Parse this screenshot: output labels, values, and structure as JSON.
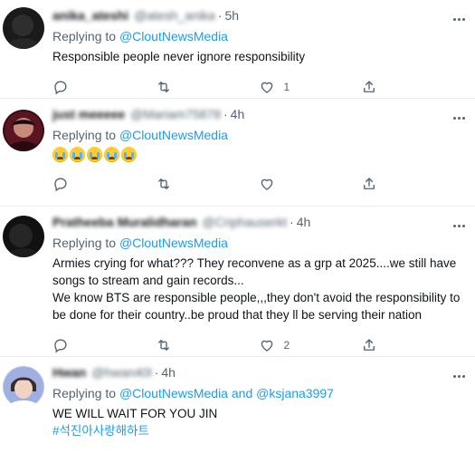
{
  "tweets": [
    {
      "name": "anika_ateshi",
      "handle": "@atesh_anika",
      "time": "5h",
      "replying_prefix": "Replying to",
      "mentions": [
        "@CloutNewsMedia"
      ],
      "text": "Responsible people never ignore  responsibility",
      "counts": {
        "reply": "",
        "retweet": "",
        "like": "1"
      }
    },
    {
      "name": "just meeeee",
      "handle": "@Mariam75878",
      "time": "4h",
      "replying_prefix": "Replying to",
      "mentions": [
        "@CloutNewsMedia"
      ],
      "emoji_count": 5,
      "emoji_name": "loudly-crying-face",
      "counts": {
        "reply": "",
        "retweet": "",
        "like": ""
      }
    },
    {
      "name": "Pratheeba Muralidharan",
      "handle": "@Criphauserkt",
      "time": "4h",
      "replying_prefix": "Replying to",
      "mentions": [
        "@CloutNewsMedia"
      ],
      "text": "Armies crying for what??? They reconvene as a grp at 2025....we still have songs to stream and gain records...\nWe know BTS are responsible people,,,they don't avoid the responsibility to be done for their country..be proud that they ll be serving their nation",
      "counts": {
        "reply": "",
        "retweet": "",
        "like": "2"
      }
    },
    {
      "name": "Hwan",
      "handle": "@hwan40l",
      "time": "4h",
      "replying_prefix": "Replying to",
      "mentions": [
        "@CloutNewsMedia",
        "@ksjana3997"
      ],
      "mention_joiner": "and",
      "text": "WE WILL WAIT FOR YOU JIN",
      "hashtag": "#석진아사랑해하트"
    }
  ],
  "separator_dot": "·",
  "icons": [
    "reply-icon",
    "retweet-icon",
    "like-icon",
    "share-icon",
    "more-icon"
  ],
  "colors": {
    "accent": "#1d9bf0",
    "muted": "#536471",
    "text": "#0f1419",
    "divider": "#e6ecf0"
  }
}
